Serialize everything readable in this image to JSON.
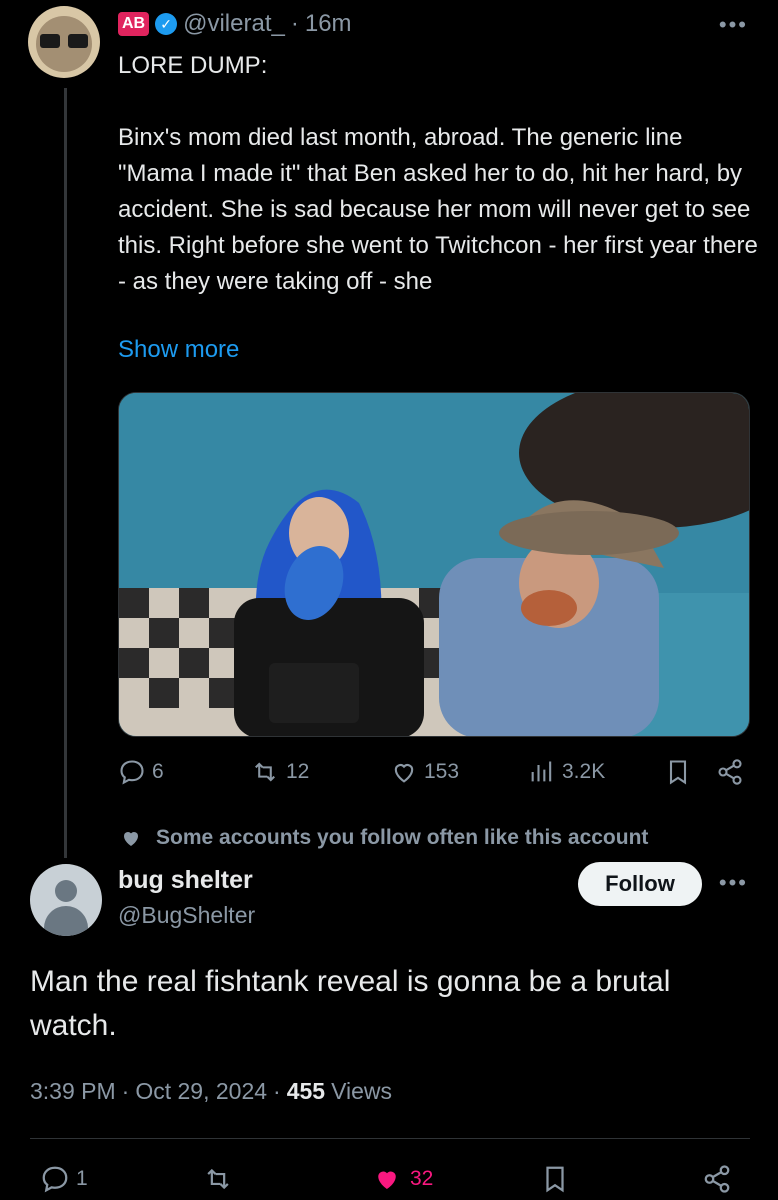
{
  "post": {
    "badge": "AB",
    "handle": "@vilerat_",
    "separator": "·",
    "time": "16m",
    "text": "LORE DUMP:\n\nBinx's mom died last month, abroad. The generic line \"Mama I made it\" that Ben asked her to do, hit her hard, by accident. She is sad because her mom will never get to see this. Right before she went to Twitchcon - her first year there - as they were taking off - she",
    "show_more": "Show more",
    "actions": {
      "replies": "6",
      "reposts": "12",
      "likes": "153",
      "views": "3.2K"
    }
  },
  "social_context": "Some accounts you follow often like this account",
  "reply": {
    "name": "bug shelter",
    "handle": "@BugShelter",
    "follow_label": "Follow",
    "text": "Man the real fishtank reveal is gonna be a brutal watch.",
    "time": "3:39 PM",
    "date": "Oct 29, 2024",
    "views_count": "455",
    "views_label": "Views",
    "dot": "·",
    "actions": {
      "replies": "1",
      "likes": "32"
    }
  },
  "colors": {
    "accent": "#1d9bf0",
    "like": "#f91880",
    "muted": "#8b98a5",
    "badge": "#e0245e"
  }
}
